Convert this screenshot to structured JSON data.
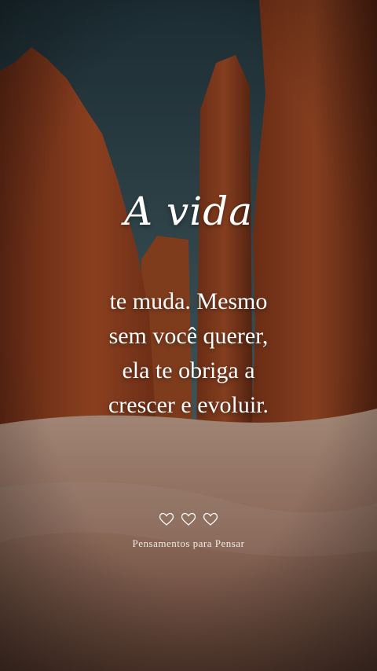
{
  "title": "A vida",
  "lines": [
    "te muda. Mesmo",
    "sem você querer,",
    "ela te obriga a",
    "crescer e evoluir."
  ],
  "hearts": [
    "heart-icon",
    "heart-icon",
    "heart-icon"
  ],
  "credit": "Pensamentos para Pensar",
  "colors": {
    "sky_top": "#1f3a46",
    "sky_bottom": "#5f8a93",
    "rock": "#b8542a",
    "rock_dark": "#6b2c16",
    "sand": "#c9a08a",
    "text": "#ffffff"
  }
}
